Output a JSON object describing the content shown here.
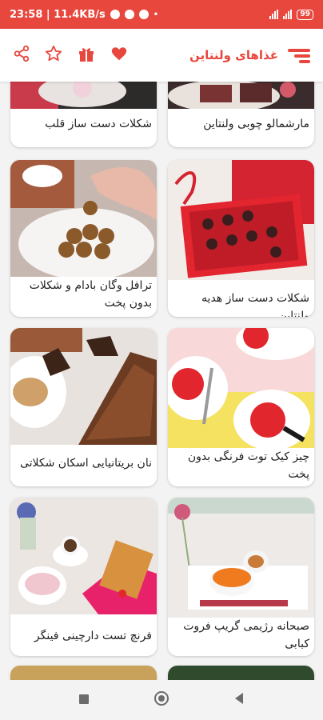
{
  "status_bar": {
    "time_speed": "23:58 | 11.4KB/s",
    "battery": "99"
  },
  "app_bar": {
    "title": "غذاهای ولنتاین"
  },
  "icons": {
    "share": "share-icon",
    "star": "star-icon",
    "gift": "gift-icon",
    "heart": "heart-icon",
    "menu": "menu-icon"
  },
  "colors": {
    "accent": "#e8473d",
    "background": "#f3f3f3"
  },
  "cards": [
    {
      "label": "مارشمالو چوبی ولنتاین"
    },
    {
      "label": "شکلات دست ساز قلب"
    },
    {
      "label": "شکلات دست ساز هدیه ولنتاین"
    },
    {
      "label": "ترافل وگان بادام و شکلات بدون پخت"
    },
    {
      "label": "چیز کیک توت فرنگی بدون پخت"
    },
    {
      "label": "نان بریتانیایی اسکان شکلاتی"
    },
    {
      "label": "صبحانه رژیمی گریپ فروت کبابی"
    },
    {
      "label": "فرنچ تست دارچینی فینگر"
    }
  ]
}
